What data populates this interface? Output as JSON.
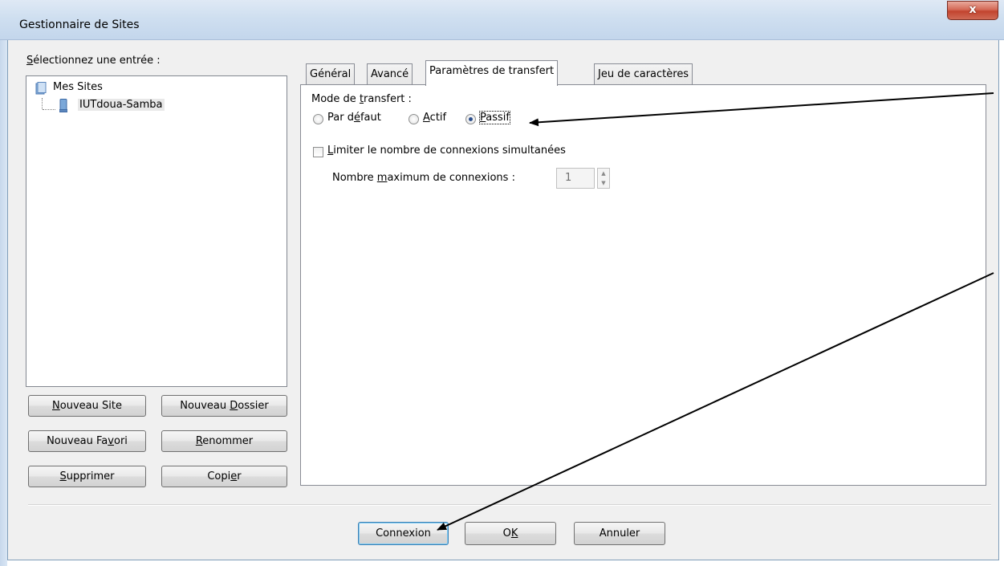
{
  "window": {
    "title": "Gestionnaire de Sites",
    "close_label": "x"
  },
  "left_panel": {
    "label_pre": "",
    "label_mnemonic": "S",
    "label_post": "électionnez une entrée :",
    "tree": {
      "root": "Mes Sites",
      "child": "IUTdoua-Samba"
    },
    "buttons": [
      {
        "pre": "",
        "mn": "N",
        "post": "ouveau Site"
      },
      {
        "pre": "Nouveau ",
        "mn": "D",
        "post": "ossier"
      },
      {
        "pre": "Nouveau Fa",
        "mn": "v",
        "post": "ori"
      },
      {
        "pre": "",
        "mn": "R",
        "post": "enommer"
      },
      {
        "pre": "",
        "mn": "S",
        "post": "upprimer"
      },
      {
        "pre": "Copi",
        "mn": "e",
        "post": "r"
      }
    ]
  },
  "tabs": [
    {
      "label": "Général"
    },
    {
      "label": "Avancé"
    },
    {
      "label": "Paramètres de transfert"
    },
    {
      "label": "Jeu de caractères"
    }
  ],
  "transfer": {
    "mode_label_pre": "Mode de ",
    "mode_label_mn": "t",
    "mode_label_post": "ransfert :",
    "radios": [
      {
        "pre": "Par d",
        "mn": "é",
        "post": "faut",
        "checked": false
      },
      {
        "pre": "",
        "mn": "A",
        "post": "ctif",
        "checked": false
      },
      {
        "pre": "",
        "mn": "P",
        "post": "assif",
        "checked": true
      }
    ],
    "limit_pre": "",
    "limit_mn": "L",
    "limit_post": "imiter le nombre de connexions simultanées",
    "limit_checked": false,
    "max_pre": "Nombre ",
    "max_mn": "m",
    "max_post": "aximum de connexions :",
    "max_value": "1"
  },
  "footer": {
    "connect": "Connexion",
    "ok_pre": "O",
    "ok_mn": "K",
    "cancel": "Annuler"
  },
  "colors": {
    "arrow": "#000000",
    "accent_default_button": "#3c7fb1"
  }
}
